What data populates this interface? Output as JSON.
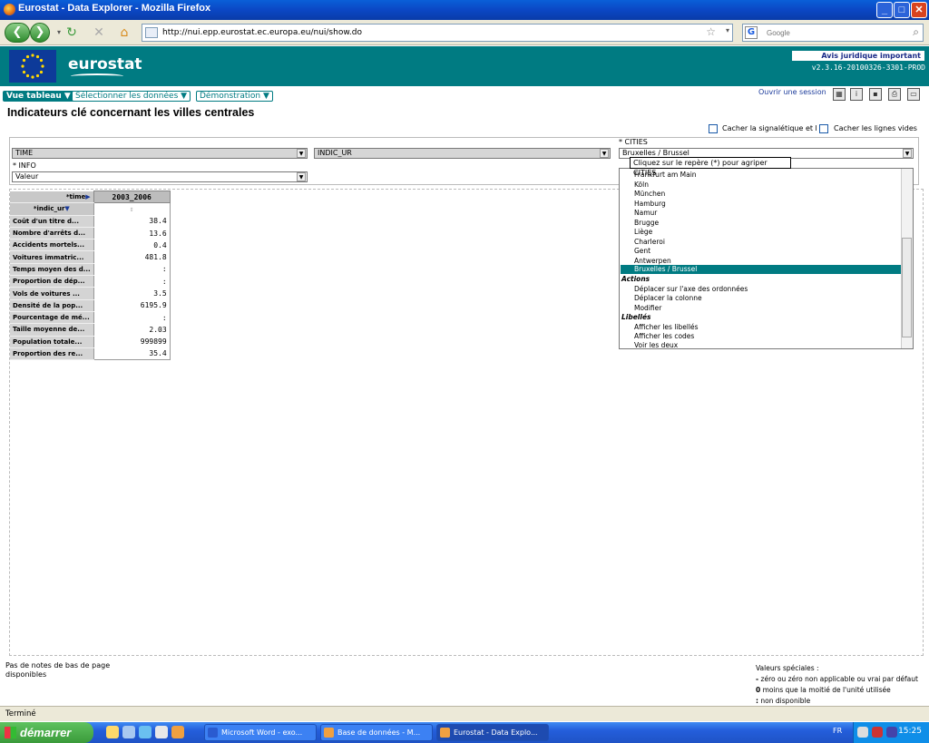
{
  "window": {
    "title": "Eurostat - Data Explorer - Mozilla Firefox"
  },
  "browser": {
    "url": "http://nui.epp.eurostat.ec.europa.eu/nui/show.do",
    "search_placeholder": "Google"
  },
  "header": {
    "logo": "eurostat",
    "legal": "Avis juridique important",
    "version": "v2.3.16-20100326-3301-PROD"
  },
  "tabs": [
    {
      "label": "Vue tableau ▼"
    },
    {
      "label": "Sélectionner les données ▼"
    },
    {
      "label": "Démonstration ▼"
    }
  ],
  "session_link": "Ouvrir une session",
  "page_title": "Indicateurs clé concernant les villes centrales",
  "options": {
    "hide_metadata": "Cacher la signalétique et l",
    "hide_empty": "Cacher les lignes vides"
  },
  "selectors": {
    "time": "TIME",
    "indic": "INDIC_UR",
    "cities_label": "* CITIES",
    "cities_value": "Bruxelles / Brussel",
    "info_label": "* INFO",
    "info_value": "Valeur"
  },
  "tooltip": "Cliquez sur le repère (*) pour agriper CITIES",
  "dropdown": {
    "cities": [
      "Frankfurt am Main",
      "Köln",
      "München",
      "Hamburg",
      "Namur",
      "Brugge",
      "Liège",
      "Charleroi",
      "Gent",
      "Antwerpen",
      "Bruxelles / Brussel"
    ],
    "actions_header": "Actions",
    "actions": [
      "Déplacer sur l'axe des ordonnées",
      "Déplacer la colonne",
      "Modifier"
    ],
    "labels_header": "Libellés",
    "labels": [
      "Afficher les libellés",
      "Afficher les codes",
      "Voir les deux"
    ]
  },
  "table": {
    "time_header": "*time",
    "indic_header": "*indic_ur",
    "column": "2003_2006",
    "rows": [
      {
        "label": "Coût d'un titre d...",
        "value": "38.4"
      },
      {
        "label": "Nombre d'arrêts d...",
        "value": "13.6"
      },
      {
        "label": "Accidents mortels...",
        "value": "0.4"
      },
      {
        "label": "Voitures immatric...",
        "value": "481.8"
      },
      {
        "label": "Temps moyen des d...",
        "value": ":"
      },
      {
        "label": "Proportion de dép...",
        "value": ":"
      },
      {
        "label": "Vols de voitures ...",
        "value": "3.5"
      },
      {
        "label": "Densité de la pop...",
        "value": "6195.9"
      },
      {
        "label": "Pourcentage de mé...",
        "value": ":"
      },
      {
        "label": "Taille moyenne de...",
        "value": "2.03"
      },
      {
        "label": "Population totale...",
        "value": "999899"
      },
      {
        "label": "Proportion des re...",
        "value": "35.4"
      }
    ]
  },
  "footer": {
    "notes": "Pas de notes de bas de page disponibles",
    "special_title": "Valeurs spéciales :",
    "special": [
      {
        "sym": "-",
        "text": "zéro ou zéro non applicable ou vrai par défaut"
      },
      {
        "sym": "0",
        "text": "moins que la moitié de l'unité utilisée"
      },
      {
        "sym": ":",
        "text": "non disponible"
      }
    ]
  },
  "status": "Terminé",
  "taskbar": {
    "start": "démarrer",
    "tasks": [
      "Microsoft Word - exo...",
      "Base de données - M...",
      "Eurostat - Data Explo..."
    ],
    "lang": "FR",
    "clock": "15:25"
  }
}
